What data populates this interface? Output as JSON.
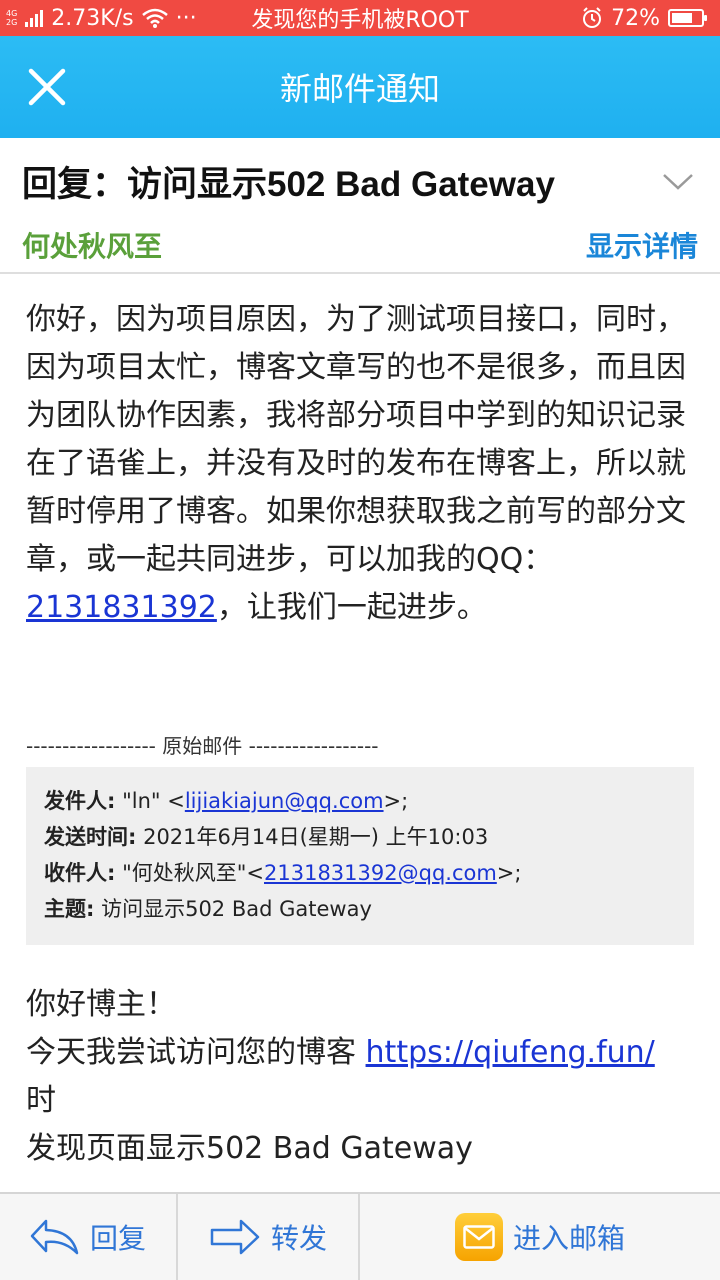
{
  "status_bar": {
    "network_top": "4G",
    "network_bottom": "2G",
    "speed": "2.73K/s",
    "dots": "···",
    "notice": "发现您的手机被ROOT",
    "battery": "72%"
  },
  "header": {
    "title": "新邮件通知"
  },
  "email": {
    "subject": "回复：访问显示502 Bad Gateway",
    "sender": "何处秋风至",
    "details_link": "显示详情",
    "body_part1": "你好，因为项目原因，为了测试项目接口，同时，因为项目太忙，博客文章写的也不是很多，而且因为团队协作因素，我将部分项目中学到的知识记录在了语雀上，并没有及时的发布在博客上，所以就暂时停用了博客。如果你想获取我之前写的部分文章，或一起共同进步，可以加我的QQ：",
    "qq_link": "2131831392",
    "body_part2": "，让我们一起进步。",
    "divider": "------------------ 原始邮件 ------------------",
    "original": {
      "from_label": "发件人:",
      "from_name": " \"ln\" <",
      "from_email": "lijiakiajun@qq.com",
      "from_end": ">;",
      "date_label": "发送时间:",
      "date_value": " 2021年6月14日(星期一) 上午10:03",
      "to_label": "收件人:",
      "to_name": " \"何处秋风至\"<",
      "to_email": "2131831392@qq.com",
      "to_end": ">;",
      "subject_label": "主题:",
      "subject_value": " 访问显示502 Bad Gateway"
    },
    "greeting": "你好博主！",
    "line2_pre": "今天我尝试访问您的博客 ",
    "blog_link": "https://qiufeng.fun/",
    "line2_post": " 时",
    "line3": "发现页面显示502 Bad Gateway"
  },
  "bottom_bar": {
    "reply": "回复",
    "forward": "转发",
    "inbox": "进入邮箱"
  },
  "colors": {
    "status_bar": "#f04a42",
    "title_bar": "#1fb0f0",
    "sender": "#5aa03a",
    "link_blue": "#1a86d8",
    "hyperlink": "#1a35d4"
  }
}
